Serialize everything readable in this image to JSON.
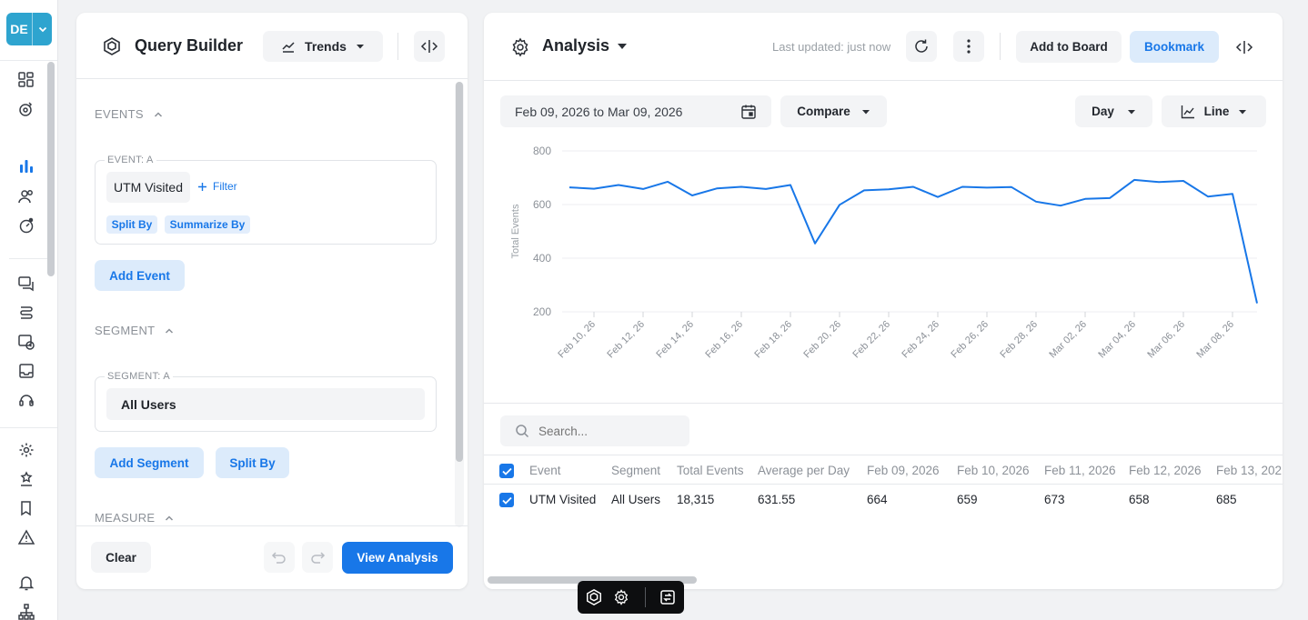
{
  "workspace": {
    "abbr": "DE"
  },
  "query_builder": {
    "title": "Query Builder",
    "type_dropdown": "Trends",
    "events_section": "EVENTS",
    "event_card_label": "EVENT: A",
    "event_name": "UTM Visited",
    "filter_label": "Filter",
    "split_by_chip": "Split By",
    "summarize_by_chip": "Summarize By",
    "add_event": "Add Event",
    "segment_section": "SEGMENT",
    "segment_card_label": "SEGMENT: A",
    "segment_value": "All Users",
    "add_segment": "Add Segment",
    "segment_split_by": "Split By",
    "measure_section": "MEASURE",
    "clear": "Clear",
    "view_analysis": "View Analysis"
  },
  "analysis": {
    "title": "Analysis",
    "last_updated": "Last updated: just now",
    "add_to_board": "Add to Board",
    "bookmark": "Bookmark",
    "date_range": "Feb 09, 2026 to Mar 09, 2026",
    "compare": "Compare",
    "interval": "Day",
    "chart_type": "Line",
    "search_placeholder": "Search..."
  },
  "chart_data": {
    "type": "line",
    "ylabel": "Total Events",
    "ylim": [
      200,
      800
    ],
    "yticks": [
      200,
      400,
      600,
      800
    ],
    "grid": true,
    "x": [
      "Feb 09, 26",
      "Feb 10, 26",
      "Feb 11, 26",
      "Feb 12, 26",
      "Feb 13, 26",
      "Feb 14, 26",
      "Feb 15, 26",
      "Feb 16, 26",
      "Feb 17, 26",
      "Feb 18, 26",
      "Feb 19, 26",
      "Feb 20, 26",
      "Feb 21, 26",
      "Feb 22, 26",
      "Feb 23, 26",
      "Feb 24, 26",
      "Feb 25, 26",
      "Feb 26, 26",
      "Feb 27, 26",
      "Feb 28, 26",
      "Mar 01, 26",
      "Mar 02, 26",
      "Mar 03, 26",
      "Mar 04, 26",
      "Mar 05, 26",
      "Mar 06, 26",
      "Mar 07, 26",
      "Mar 08, 26",
      "Mar 09, 26"
    ],
    "xtick_labels": [
      "Feb 10, 26",
      "Feb 12, 26",
      "Feb 14, 26",
      "Feb 16, 26",
      "Feb 18, 26",
      "Feb 20, 26",
      "Feb 22, 26",
      "Feb 24, 26",
      "Feb 26, 26",
      "Feb 28, 26",
      "Mar 02, 26",
      "Mar 04, 26",
      "Mar 06, 26",
      "Mar 08, 26"
    ],
    "xtick_index": [
      1,
      3,
      5,
      7,
      9,
      11,
      13,
      15,
      17,
      19,
      21,
      23,
      25,
      27
    ],
    "series": [
      {
        "values": [
          664,
          659,
          673,
          658,
          685,
          634,
          660,
          666,
          658,
          673,
          455,
          599,
          653,
          657,
          666,
          628,
          666,
          663,
          665,
          611,
          596,
          621,
          624,
          692,
          684,
          688,
          630,
          640,
          232
        ],
        "color": "#1877e8"
      }
    ]
  },
  "table": {
    "headers": [
      "Event",
      "Segment",
      "Total Events",
      "Average per Day",
      "Feb 09, 2026",
      "Feb 10, 2026",
      "Feb 11, 2026",
      "Feb 12, 2026",
      "Feb 13, 202"
    ],
    "row": [
      "UTM Visited",
      "All Users",
      "18,315",
      "631.55",
      "664",
      "659",
      "673",
      "658",
      "685"
    ]
  },
  "colors": {
    "accent": "#1877e8",
    "workspace": "#2ea4cf"
  }
}
